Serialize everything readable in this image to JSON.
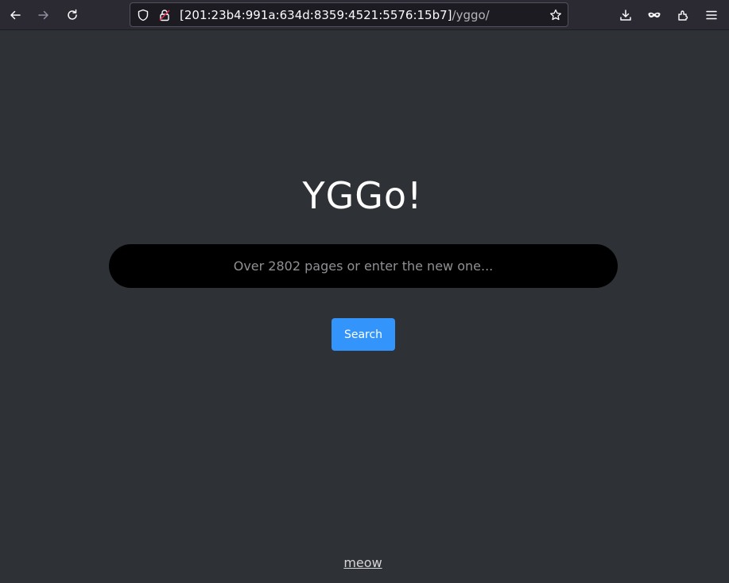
{
  "browser": {
    "url_host": "[201:23b4:991a:634d:8359:4521:5576:15b7]",
    "url_path": "/yggo/",
    "icons": [
      "back-arrow-icon",
      "forward-arrow-icon",
      "reload-icon",
      "shield-icon",
      "insecure-lock-icon",
      "star-icon",
      "download-icon",
      "mask-icon",
      "extensions-icon",
      "menu-icon"
    ]
  },
  "page": {
    "logo": "YGGo!",
    "search_placeholder": "Over 2802 pages or enter the new one...",
    "search_button": "Search",
    "footer_link": "meow"
  },
  "colors": {
    "background": "#2e3236",
    "search_field": "#000000",
    "button": "#3394fb"
  }
}
